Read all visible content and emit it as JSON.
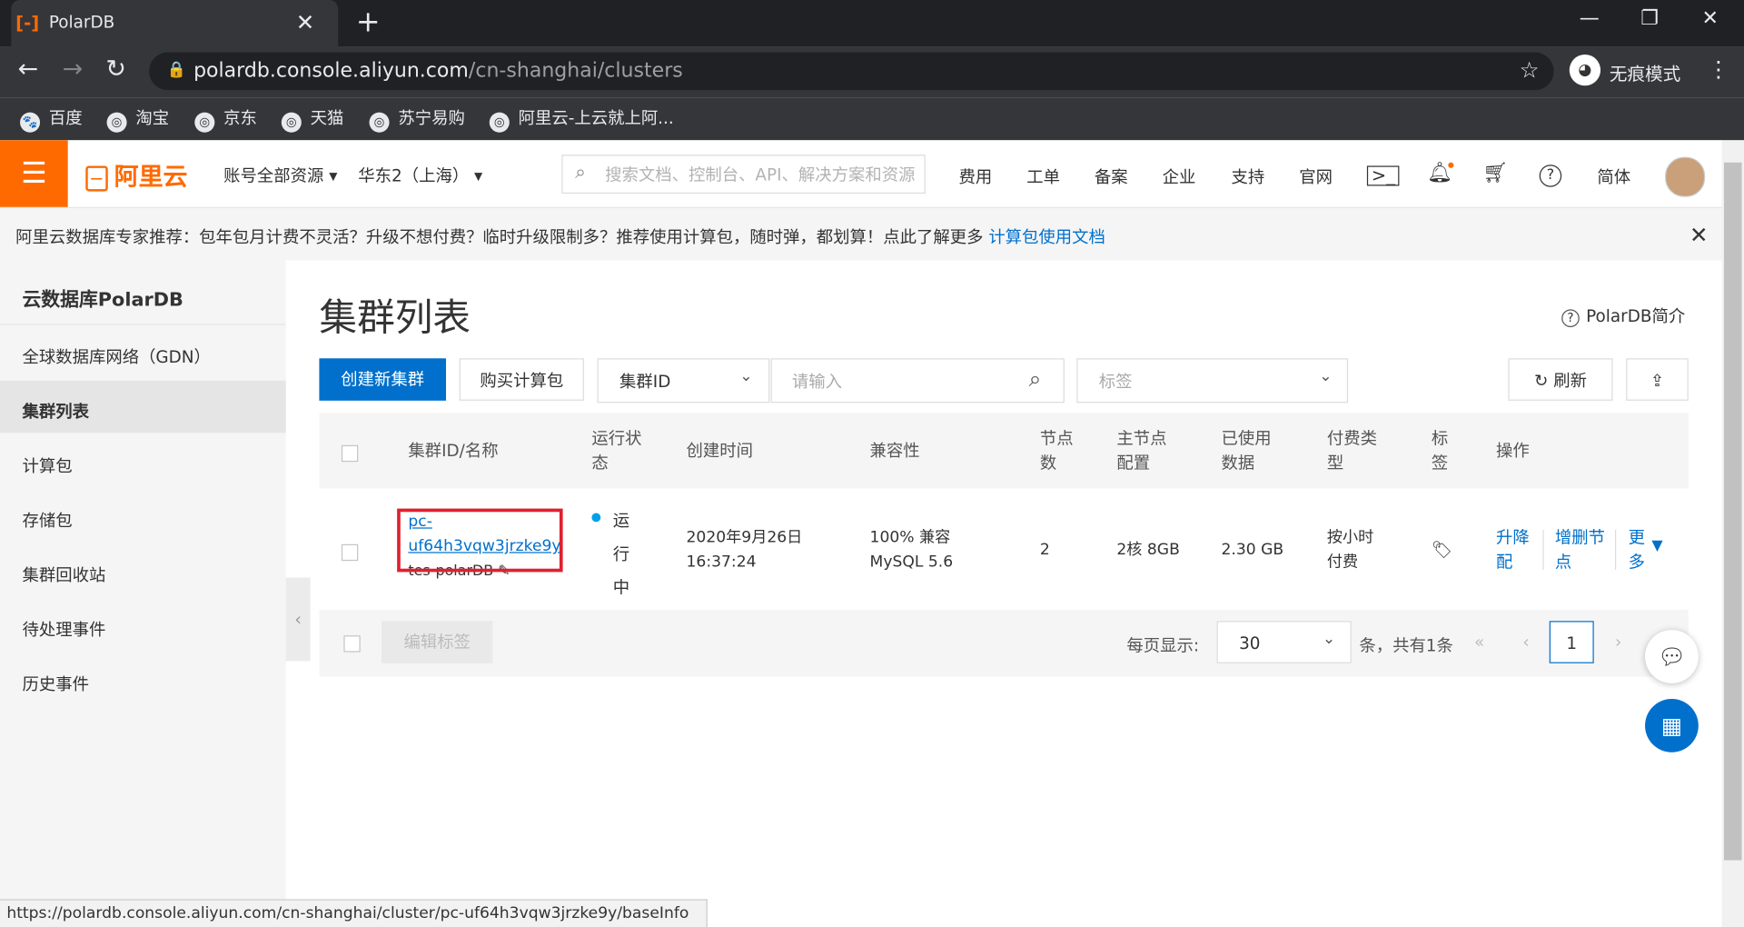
{
  "browser": {
    "tab_title": "PolarDB",
    "tab_logo": "[-]",
    "url_host": "polardb.console.aliyun.com",
    "url_path": "/cn-shanghai/clusters",
    "incognito_label": "无痕模式",
    "bookmarks": [
      "百度",
      "淘宝",
      "京东",
      "天猫",
      "苏宁易购",
      "阿里云-上云就上阿..."
    ],
    "status_url": "https://polardb.console.aliyun.com/cn-shanghai/cluster/pc-uf64h3vqw3jrzke9y/baseInfo"
  },
  "topbar": {
    "brand": "阿里云",
    "account_scope": "账号全部资源",
    "region": "华东2（上海）",
    "search_placeholder": "搜索文档、控制台、API、解决方案和资源",
    "nav": [
      "费用",
      "工单",
      "备案",
      "企业",
      "支持",
      "官网"
    ],
    "lang": "简体"
  },
  "notice": {
    "text": "阿里云数据库专家推荐：包年包月计费不灵活？升级不想付费？临时升级限制多？推荐使用计算包，随时弹，都划算！点此了解更多 ",
    "link": "计算包使用文档"
  },
  "sidebar": {
    "title": "云数据库PolarDB",
    "items": [
      "全球数据库网络（GDN）",
      "集群列表",
      "计算包",
      "存储包",
      "集群回收站",
      "待处理事件",
      "历史事件"
    ],
    "active_index": 1
  },
  "main": {
    "title": "集群列表",
    "intro_link": "PolarDB简介",
    "create_button": "创建新集群",
    "buy_button": "购买计算包",
    "filter_field": "集群ID",
    "filter_placeholder": "请输入",
    "tag_placeholder": "标签",
    "refresh_button": "刷新"
  },
  "table": {
    "headers": {
      "id": "集群ID/名称",
      "status": "运行状态",
      "created": "创建时间",
      "compat": "兼容性",
      "nodes": "节点数",
      "spec": "主节点配置",
      "used": "已使用数据",
      "billing": "付费类型",
      "tag": "标签",
      "ops": "操作"
    },
    "rows": [
      {
        "id_line1": "pc-",
        "id_line2": "uf64h3vqw3jrzke9y",
        "name": "tes-polarDB",
        "status": "运行中",
        "created_date": "2020年9月26日",
        "created_time": "16:37:24",
        "compat_line1": "100% 兼容",
        "compat_line2": "MySQL 5.6",
        "nodes": "2",
        "spec": "2核 8GB",
        "used": "2.30 GB",
        "billing_line1": "按小时",
        "billing_line2": "付费",
        "op1": "升降配",
        "op2": "增删节点",
        "op3": "更多"
      }
    ]
  },
  "footer": {
    "edit_tags": "编辑标签",
    "page_size_label": "每页显示:",
    "page_size": "30",
    "total": "条，共有1条",
    "current_page": "1"
  }
}
